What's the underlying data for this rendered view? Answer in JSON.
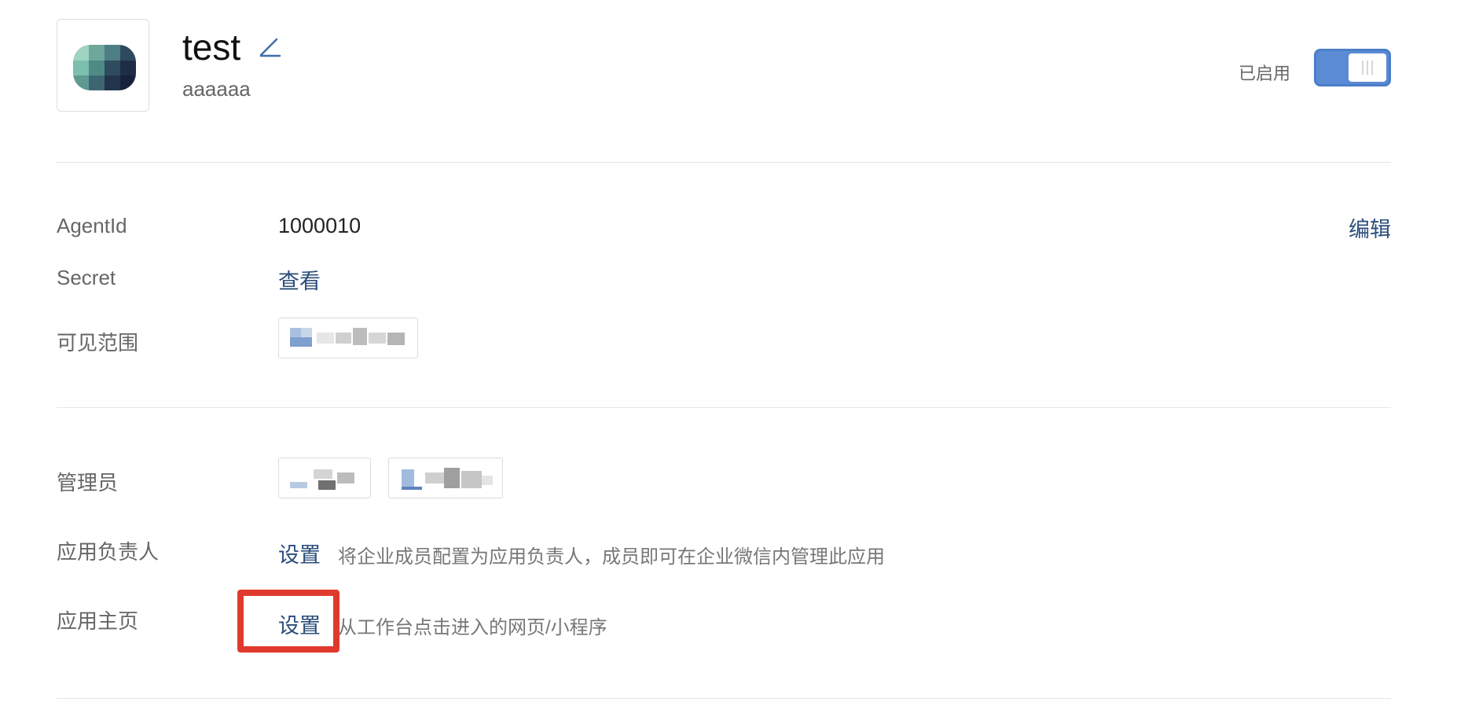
{
  "app": {
    "name": "test",
    "description": "aaaaaa",
    "status_label": "已启用",
    "enabled": true
  },
  "details": {
    "agentid_label": "AgentId",
    "agentid_value": "1000010",
    "edit_label": "编辑",
    "secret_label": "Secret",
    "secret_link": "查看",
    "visible_label": "可见范围"
  },
  "management": {
    "admin_label": "管理员",
    "owner_label": "应用负责人",
    "owner_link": "设置",
    "owner_hint": "将企业成员配置为应用负责人，成员即可在企业微信内管理此应用",
    "home_label": "应用主页",
    "home_link": "设置",
    "home_hint": "从工作台点击进入的网页/小程序"
  },
  "colors": {
    "accent": "#5b8bd4",
    "link": "#2b4d7a",
    "highlight": "#e03a2f"
  },
  "icons": {
    "app_logo": "pixel-app-logo-icon",
    "edit_name": "pencil-icon"
  }
}
